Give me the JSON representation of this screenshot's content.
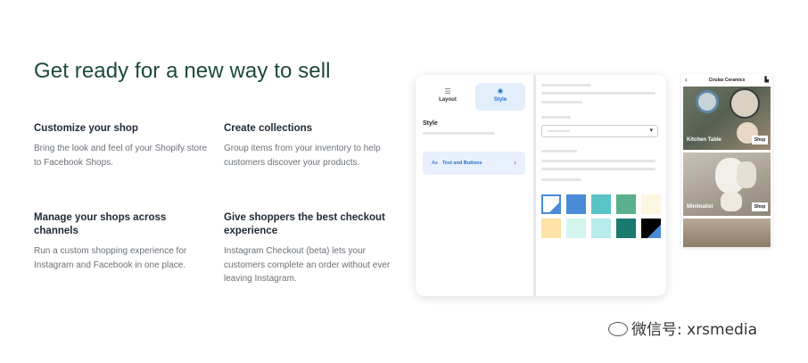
{
  "headline": "Get ready for a new way to sell",
  "features": [
    {
      "title": "Customize your shop",
      "body": "Bring the look and feel of your Shopify store to Facebook Shops."
    },
    {
      "title": "Create collections",
      "body": "Group items from your inventory to help customers discover your products."
    },
    {
      "title": "Manage your shops across channels",
      "body": "Run a custom shopping experience for Instagram and Facebook in one place."
    },
    {
      "title": "Give shoppers the best checkout experience",
      "body": "Instagram Checkout (beta) lets your customers complete an order without ever leaving Instagram."
    }
  ],
  "editor": {
    "tabs": [
      {
        "label": "Layout",
        "icon": "list-icon"
      },
      {
        "label": "Style",
        "icon": "palette-icon"
      }
    ],
    "style_label": "Style",
    "text_row": {
      "prefix": "Aa",
      "label": "Text and Buttons",
      "icon": "chevron-right-icon"
    },
    "swatches": [
      "#ffffff",
      "#4a8bd6",
      "#58c4c6",
      "#5aaf8f",
      "#fdf6e3",
      "#fde3a7",
      "#d4f5ee",
      "#b7ecec",
      "#1a7a6d",
      "#000000"
    ]
  },
  "phone": {
    "title": "Cirulas Ceramics",
    "tiles": [
      {
        "label": "Kitchen Table",
        "button": "Shop"
      },
      {
        "label": "Minimalist",
        "button": "Shop"
      }
    ]
  },
  "watermark": "微信号: xrsmedia"
}
